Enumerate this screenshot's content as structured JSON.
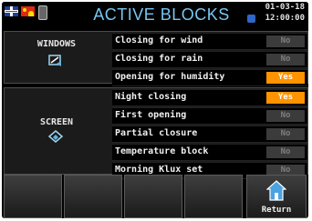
{
  "header": {
    "title": "ACTIVE BLOCKS",
    "date": "01-03-18",
    "time": "12:00:00",
    "languages": [
      "uk-flag-icon",
      "china-flag-icon"
    ]
  },
  "windows": {
    "label": "WINDOWS",
    "rows": [
      {
        "label": "Closing for wind",
        "state": "No"
      },
      {
        "label": "Closing for rain",
        "state": "No"
      },
      {
        "label": "Opening for humidity",
        "state": "Yes"
      }
    ]
  },
  "screen": {
    "label": "SCREEN",
    "rows": [
      {
        "label": "Night closing",
        "state": "Yes"
      },
      {
        "label": "First opening",
        "state": "No"
      },
      {
        "label": "Partial closure",
        "state": "No"
      },
      {
        "label": "Temperature block",
        "state": "No"
      },
      {
        "label": "Morning Klux set",
        "state": "No"
      }
    ]
  },
  "footer": {
    "return_label": "Return"
  },
  "colors": {
    "title": "#77c7f1",
    "yes": "#ff9300",
    "no": "#3b3b3b"
  }
}
